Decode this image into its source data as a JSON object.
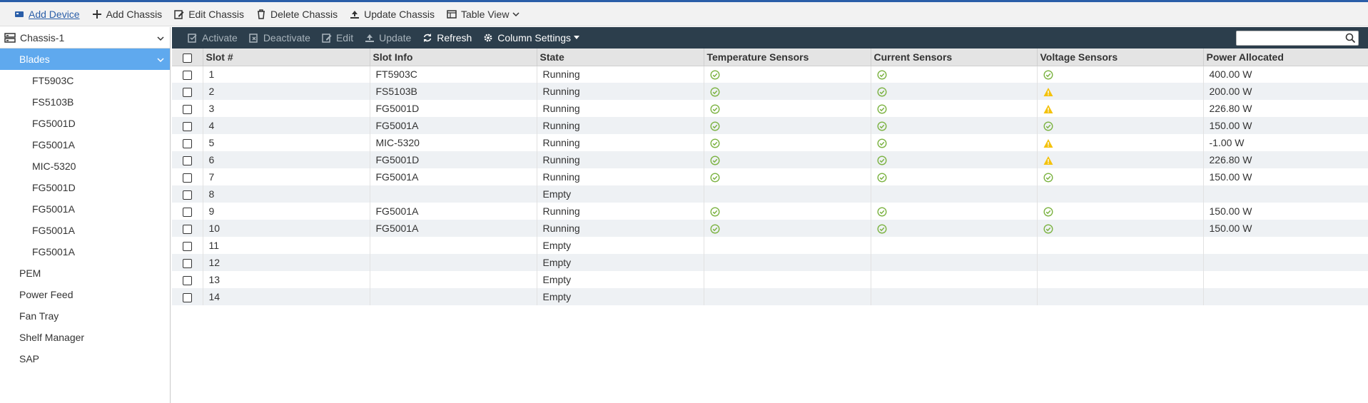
{
  "toolbar": {
    "items": [
      {
        "label": "Add Device",
        "icon": "device-icon"
      },
      {
        "label": "Add Chassis",
        "icon": "plus-icon"
      },
      {
        "label": "Edit Chassis",
        "icon": "edit-icon"
      },
      {
        "label": "Delete Chassis",
        "icon": "trash-icon"
      },
      {
        "label": "Update Chassis",
        "icon": "update-icon"
      },
      {
        "label": "Table View",
        "icon": "table-icon"
      }
    ]
  },
  "sidebar": {
    "root": "Chassis-1",
    "selected": "Blades",
    "children": [
      "FT5903C",
      "FS5103B",
      "FG5001D",
      "FG5001A",
      "MIC-5320",
      "FG5001D",
      "FG5001A",
      "FG5001A",
      "FG5001A"
    ],
    "others": [
      "PEM",
      "Power Feed",
      "Fan Tray",
      "Shelf Manager",
      "SAP"
    ]
  },
  "actions": {
    "activate": "Activate",
    "deactivate": "Deactivate",
    "edit": "Edit",
    "update": "Update",
    "refresh": "Refresh",
    "column_settings": "Column Settings"
  },
  "search": {
    "placeholder": ""
  },
  "table": {
    "columns": [
      "Slot #",
      "Slot Info",
      "State",
      "Temperature Sensors",
      "Current Sensors",
      "Voltage Sensors",
      "Power Allocated"
    ],
    "rows": [
      {
        "slot": "1",
        "info": "FT5903C",
        "state": "Running",
        "temp": "ok",
        "current": "ok",
        "voltage": "ok",
        "power": "400.00 W"
      },
      {
        "slot": "2",
        "info": "FS5103B",
        "state": "Running",
        "temp": "ok",
        "current": "ok",
        "voltage": "warn",
        "power": "200.00 W"
      },
      {
        "slot": "3",
        "info": "FG5001D",
        "state": "Running",
        "temp": "ok",
        "current": "ok",
        "voltage": "warn",
        "power": "226.80 W"
      },
      {
        "slot": "4",
        "info": "FG5001A",
        "state": "Running",
        "temp": "ok",
        "current": "ok",
        "voltage": "ok",
        "power": "150.00 W"
      },
      {
        "slot": "5",
        "info": "MIC-5320",
        "state": "Running",
        "temp": "ok",
        "current": "ok",
        "voltage": "warn",
        "power": "-1.00 W"
      },
      {
        "slot": "6",
        "info": "FG5001D",
        "state": "Running",
        "temp": "ok",
        "current": "ok",
        "voltage": "warn",
        "power": "226.80 W"
      },
      {
        "slot": "7",
        "info": "FG5001A",
        "state": "Running",
        "temp": "ok",
        "current": "ok",
        "voltage": "ok",
        "power": "150.00 W"
      },
      {
        "slot": "8",
        "info": "",
        "state": "Empty",
        "temp": "",
        "current": "",
        "voltage": "",
        "power": ""
      },
      {
        "slot": "9",
        "info": "FG5001A",
        "state": "Running",
        "temp": "ok",
        "current": "ok",
        "voltage": "ok",
        "power": "150.00 W"
      },
      {
        "slot": "10",
        "info": "FG5001A",
        "state": "Running",
        "temp": "ok",
        "current": "ok",
        "voltage": "ok",
        "power": "150.00 W"
      },
      {
        "slot": "11",
        "info": "",
        "state": "Empty",
        "temp": "",
        "current": "",
        "voltage": "",
        "power": ""
      },
      {
        "slot": "12",
        "info": "",
        "state": "Empty",
        "temp": "",
        "current": "",
        "voltage": "",
        "power": ""
      },
      {
        "slot": "13",
        "info": "",
        "state": "Empty",
        "temp": "",
        "current": "",
        "voltage": "",
        "power": ""
      },
      {
        "slot": "14",
        "info": "",
        "state": "Empty",
        "temp": "",
        "current": "",
        "voltage": "",
        "power": ""
      }
    ]
  },
  "colors": {
    "accent": "#2a5ea8",
    "selected": "#5fa9ee",
    "dark_bar": "#2c3e4c",
    "ok": "#7cb342",
    "warn": "#f4c20d"
  }
}
